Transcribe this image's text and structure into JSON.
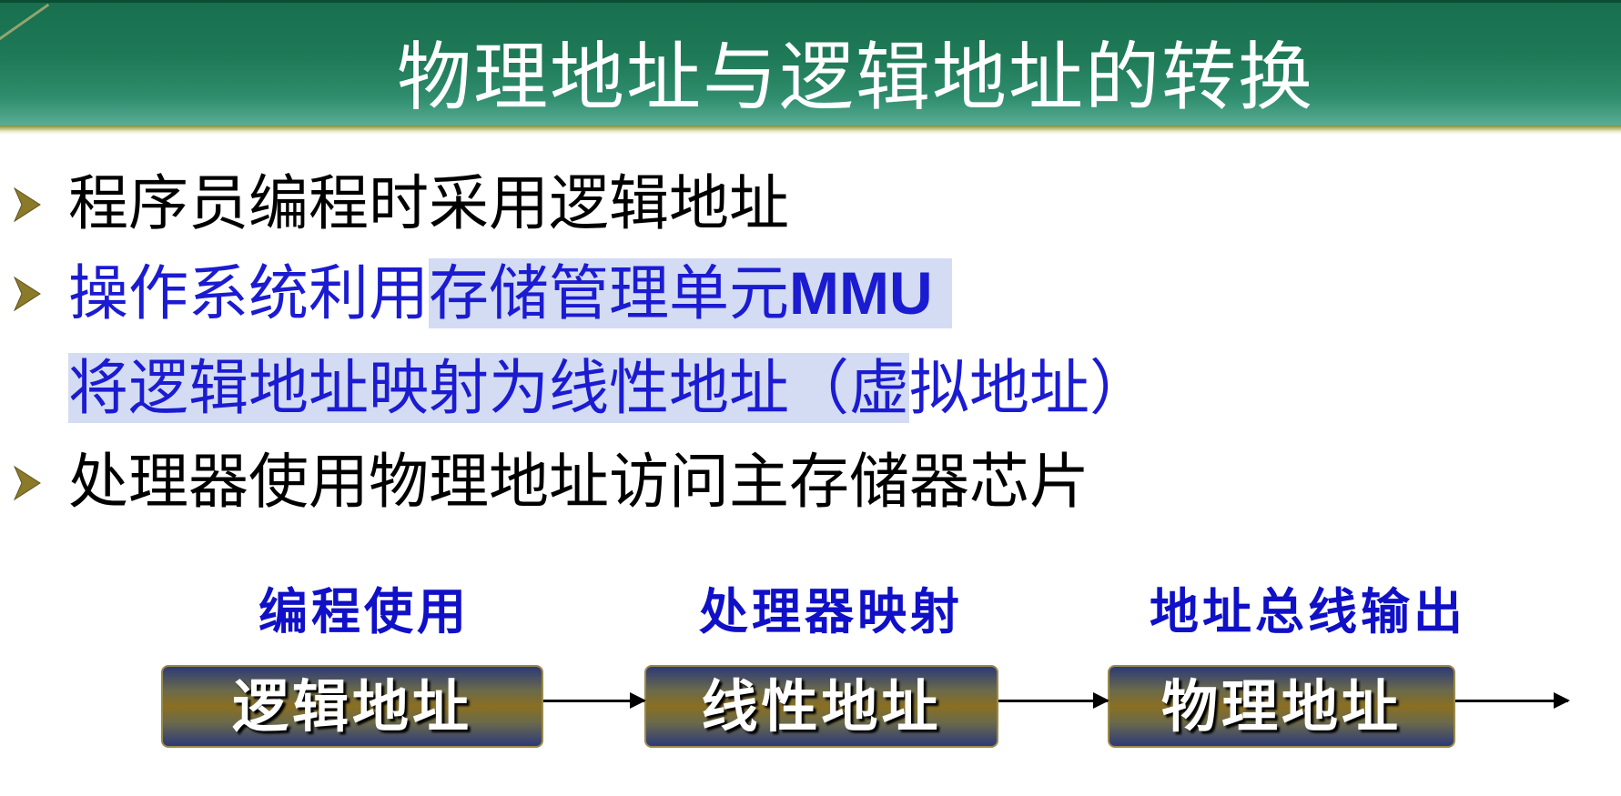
{
  "slide": {
    "title": "物理地址与逻辑地址的转换"
  },
  "bullets": {
    "b1": "程序员编程时采用逻辑地址",
    "b2_part1": "操作系统利用",
    "b2_part2": "存储管理单元",
    "b2_mmu": "MMU",
    "b2_line2_part1": "将逻辑地址映射为线性地址（虚",
    "b2_line2_part2": "拟地址）",
    "b3": "处理器使用物理地址访问主存储器芯片"
  },
  "diagram": {
    "labels": {
      "programming": "编程使用",
      "processor_map": "处理器映射",
      "bus_output": "地址总线输出"
    },
    "boxes": {
      "logical": "逻辑地址",
      "linear": "线性地址",
      "physical": "物理地址"
    }
  },
  "colors": {
    "title_bar": "#1f7a58",
    "emphasis_text": "#1b1bd2",
    "highlight": "#d3dcf3",
    "bullet_marker": "#8a7a2a"
  }
}
